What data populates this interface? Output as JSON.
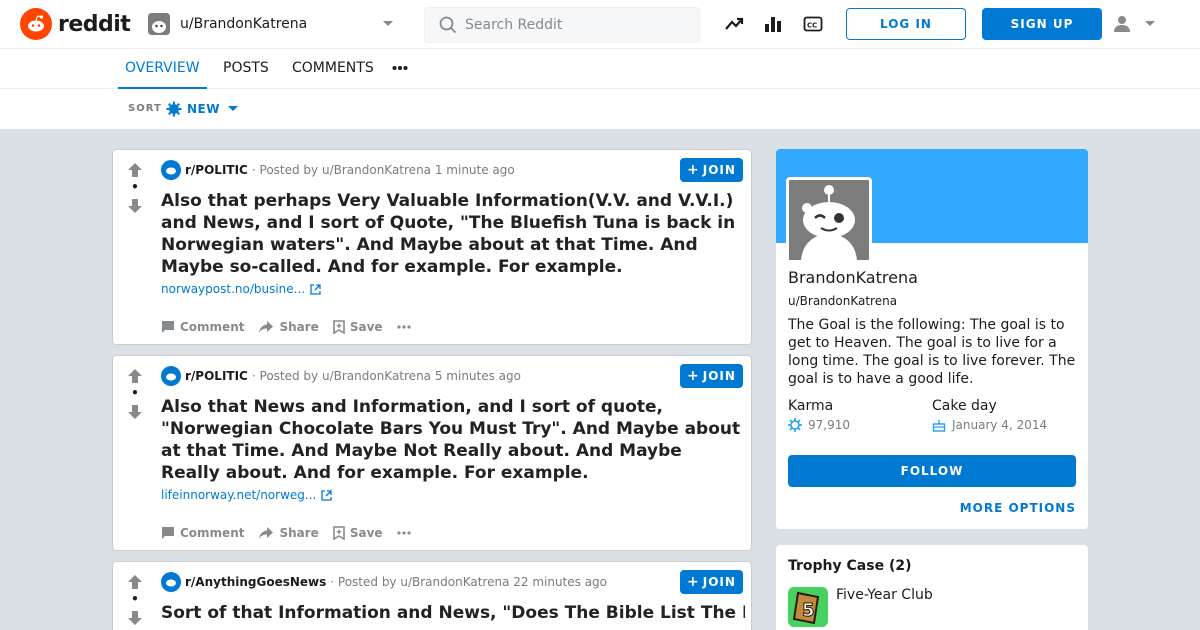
{
  "header": {
    "logo_text": "reddit",
    "user_dropdown": "u/BrandonKatrena",
    "search_placeholder": "Search Reddit",
    "login_label": "LOG IN",
    "signup_label": "SIGN UP"
  },
  "tabs": [
    {
      "label": "OVERVIEW",
      "active": true
    },
    {
      "label": "POSTS",
      "active": false
    },
    {
      "label": "COMMENTS",
      "active": false
    }
  ],
  "sort": {
    "label": "SORT",
    "value": "NEW"
  },
  "posts": [
    {
      "subreddit": "r/POLITIC",
      "meta": "· Posted by u/BrandonKatrena 1 minute ago",
      "title": "Also that perhaps Very Valuable Information(V.V. and V.V.I.) and News, and I sort of Quote, \"The Bluefish Tuna is back in Norwegian waters\". And Maybe about at that Time. And Maybe so-called. And for example. For example.",
      "link": "norwaypost.no/busine...",
      "join": "JOIN",
      "score": "•"
    },
    {
      "subreddit": "r/POLITIC",
      "meta": "· Posted by u/BrandonKatrena 5 minutes ago",
      "title": "Also that News and Information, and I sort of quote, \"Norwegian Chocolate Bars You Must Try\". And Maybe about at that Time. And Maybe Not Really about. And Maybe Really about. And for example. For example.",
      "link": "lifeinnorway.net/norweg...",
      "join": "JOIN",
      "score": "•"
    },
    {
      "subreddit": "r/AnythingGoesNews",
      "meta": "· Posted by u/BrandonKatrena 22 minutes ago",
      "title": "Sort of that Information and News, \"Does The Bible List The Names Of",
      "join": "JOIN",
      "score": "•"
    }
  ],
  "actions": {
    "comment": "Comment",
    "share": "Share",
    "save": "Save"
  },
  "profile": {
    "name": "BrandonKatrena",
    "username": "u/BrandonKatrena",
    "description": "The Goal is the following: The goal is to get to Heaven. The goal is to live for a long time. The goal is to live forever. The goal is to have a good life.",
    "karma_label": "Karma",
    "karma_value": "97,910",
    "cake_label": "Cake day",
    "cake_value": "January 4, 2014",
    "follow_label": "FOLLOW",
    "more_label": "MORE OPTIONS"
  },
  "trophy": {
    "title": "Trophy Case (2)",
    "items": [
      {
        "name": "Five-Year Club"
      }
    ]
  },
  "colors": {
    "accent": "#0079d3",
    "brand": "#ff4500",
    "banner": "#33a8ff"
  }
}
